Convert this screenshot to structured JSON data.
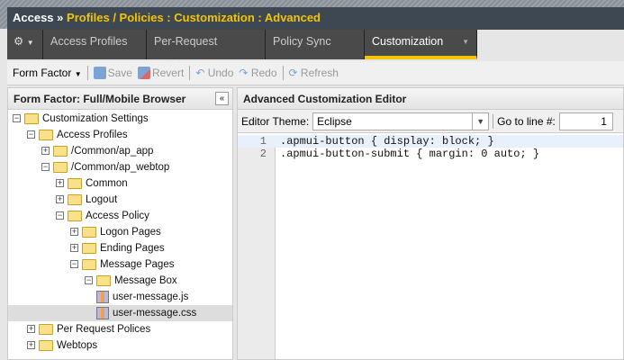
{
  "header": {
    "section": "Access",
    "sep": "»",
    "path": "Profiles / Policies : Customization : Advanced"
  },
  "nav": {
    "tabs": [
      "Access Profiles",
      "Per-Request Policies",
      "Policy Sync",
      "Customization"
    ],
    "active": "Customization"
  },
  "toolbar": {
    "form_factor": "Form Factor",
    "save": "Save",
    "revert": "Revert",
    "undo": "Undo",
    "redo": "Redo",
    "refresh": "Refresh"
  },
  "left": {
    "title": "Form Factor: Full/Mobile Browser",
    "collapse": "«",
    "tree": [
      {
        "label": "Customization Settings",
        "level": 0,
        "type": "folder",
        "state": "-"
      },
      {
        "label": "Access Profiles",
        "level": 1,
        "type": "folder",
        "state": "-"
      },
      {
        "label": "/Common/ap_app",
        "level": 2,
        "type": "folder",
        "state": "+"
      },
      {
        "label": "/Common/ap_webtop",
        "level": 2,
        "type": "folder",
        "state": "-"
      },
      {
        "label": "Common",
        "level": 3,
        "type": "folder",
        "state": "+"
      },
      {
        "label": "Logout",
        "level": 3,
        "type": "folder",
        "state": "+"
      },
      {
        "label": "Access Policy",
        "level": 3,
        "type": "folder",
        "state": "-"
      },
      {
        "label": "Logon Pages",
        "level": 4,
        "type": "folder",
        "state": "+"
      },
      {
        "label": "Ending Pages",
        "level": 4,
        "type": "folder",
        "state": "+"
      },
      {
        "label": "Message Pages",
        "level": 4,
        "type": "folder",
        "state": "-"
      },
      {
        "label": "Message Box",
        "level": 5,
        "type": "folder",
        "state": "-"
      },
      {
        "label": "user-message.js",
        "level": 6,
        "type": "file"
      },
      {
        "label": "user-message.css",
        "level": 6,
        "type": "file",
        "selected": true
      },
      {
        "label": "Per Request Polices",
        "level": 1,
        "type": "folder",
        "state": "+"
      },
      {
        "label": "Webtops",
        "level": 1,
        "type": "folder",
        "state": "+"
      }
    ]
  },
  "editor": {
    "title": "Advanced Customization Editor",
    "theme_label": "Editor Theme:",
    "theme": "Eclipse",
    "goto_label": "Go to line #:",
    "goto_value": "1",
    "lines": [
      {
        "n": "1",
        "text": ".apmui-button { display: block; }"
      },
      {
        "n": "2",
        "text": ".apmui-button-submit { margin: 0 auto; }"
      }
    ]
  }
}
